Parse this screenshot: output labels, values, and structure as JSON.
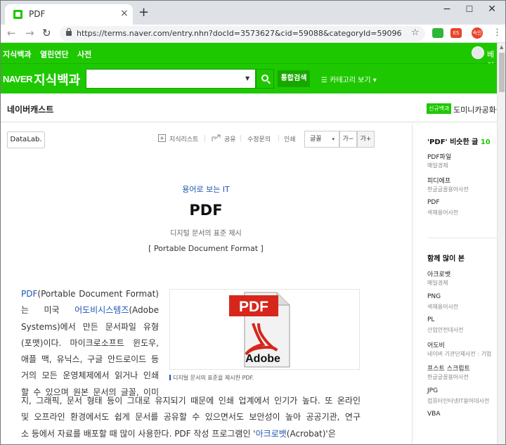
{
  "browser": {
    "tab_title": "PDF",
    "tab_close": "×",
    "new_tab": "+",
    "min": "−",
    "max": "☐",
    "close": "✕",
    "back": "←",
    "forward": "→",
    "reload": "↻",
    "url": "https://terms.naver.com/entry.nhn?docId=3573627&cid=59088&categoryId=59096",
    "star": "☆",
    "ext_red": "ES",
    "ext_profile": "속인",
    "menu": "⋮"
  },
  "gnb": {
    "links": [
      "지식백과",
      "열린연단",
      "사전"
    ],
    "user": "베이"
  },
  "header": {
    "naver": "NAVER",
    "service": "지식백과",
    "search_placeholder": "",
    "search_dropdown": "▼",
    "integrated_search": "통합검색",
    "category": "☰ 카테고리 보기 ▾"
  },
  "cast": {
    "title": "네이버캐스트",
    "badge": "신규백과",
    "right_text": "도미니카공화국"
  },
  "toolbar": {
    "datalab": "DataLab.",
    "mylist": "지식리스트",
    "share": "공유",
    "edit": "수정문의",
    "print": "인쇄",
    "font": "글꼴",
    "font_caret": "▾",
    "font_down": "가−",
    "font_up": "가+"
  },
  "article": {
    "category": "용어로 보는 IT",
    "title": "PDF",
    "subtitle": "디지털 문서의 표준 제시",
    "english": "[ Portable Document Format ]",
    "para_narrow": [
      {
        "lk": "PDF",
        "t": "(Portable Document Format)"
      },
      {
        "t": "는  미국  ",
        "lk": "어도비시스템즈",
        "t2": "(Adobe"
      },
      {
        "t": "Systems)에서 만든 문서파일 유형"
      },
      {
        "t": "(포맷)이다. 마이크로소프트 윈도우,"
      },
      {
        "t": "애플 맥, 유닉스, 구글 안드로이드 등"
      },
      {
        "t": "거의 모든 운영체제에서 읽거나 인쇄"
      },
      {
        "t": "할 수 있으며 원본 문서의 글꼴, 이미"
      }
    ],
    "para_wide": [
      "지, 그래픽, 문서 형태 등이 그대로 유지되기 때문에 인쇄 업계에서 인기가 높다. 또 온라인",
      "및 오프라인 환경에서도 쉽게 문서를 공유할 수 있으면서도 보안성이 높아 공공기관, 연구",
      "소 등에서 자료를 배포할 때 많이 사용한다. PDF 작성 프로그램인 '"
    ],
    "wide_link": "아크로뱃",
    "wide_tail": "(Acrobat)'은",
    "image_pdf_label": "PDF",
    "image_adobe_label": "Adobe",
    "caption": "디지털 문서의 표준을 제시한 PDF."
  },
  "aside": {
    "similar_title": "'PDF' 비슷한 글",
    "similar_count": "10",
    "similar": [
      {
        "name": "PDF파일",
        "src": "매일경제"
      },
      {
        "name": "피디에프",
        "src": "한글글꼴용어사전"
      },
      {
        "name": "PDF",
        "src": "색채용어사전"
      }
    ],
    "popular_title": "함께 많이 본",
    "popular": [
      {
        "name": "아크로뱃",
        "src": "매일경제"
      },
      {
        "name": "PNG",
        "src": "색채용어사전"
      },
      {
        "name": "PL",
        "src": "산업안전대사전"
      },
      {
        "name": "어도비",
        "src": "네이버 기관단체사전 : 기업"
      },
      {
        "name": "프스트 스크립트",
        "src": "한글글꼴용어사전"
      },
      {
        "name": "JPG",
        "src": "컴퓨터인터넷IT용어대사전"
      },
      {
        "name": "VBA",
        "src": ""
      }
    ]
  },
  "colors": {
    "naver_green": "#1ec800",
    "link_blue": "#1e56b4",
    "pdf_red": "#d7261c"
  }
}
